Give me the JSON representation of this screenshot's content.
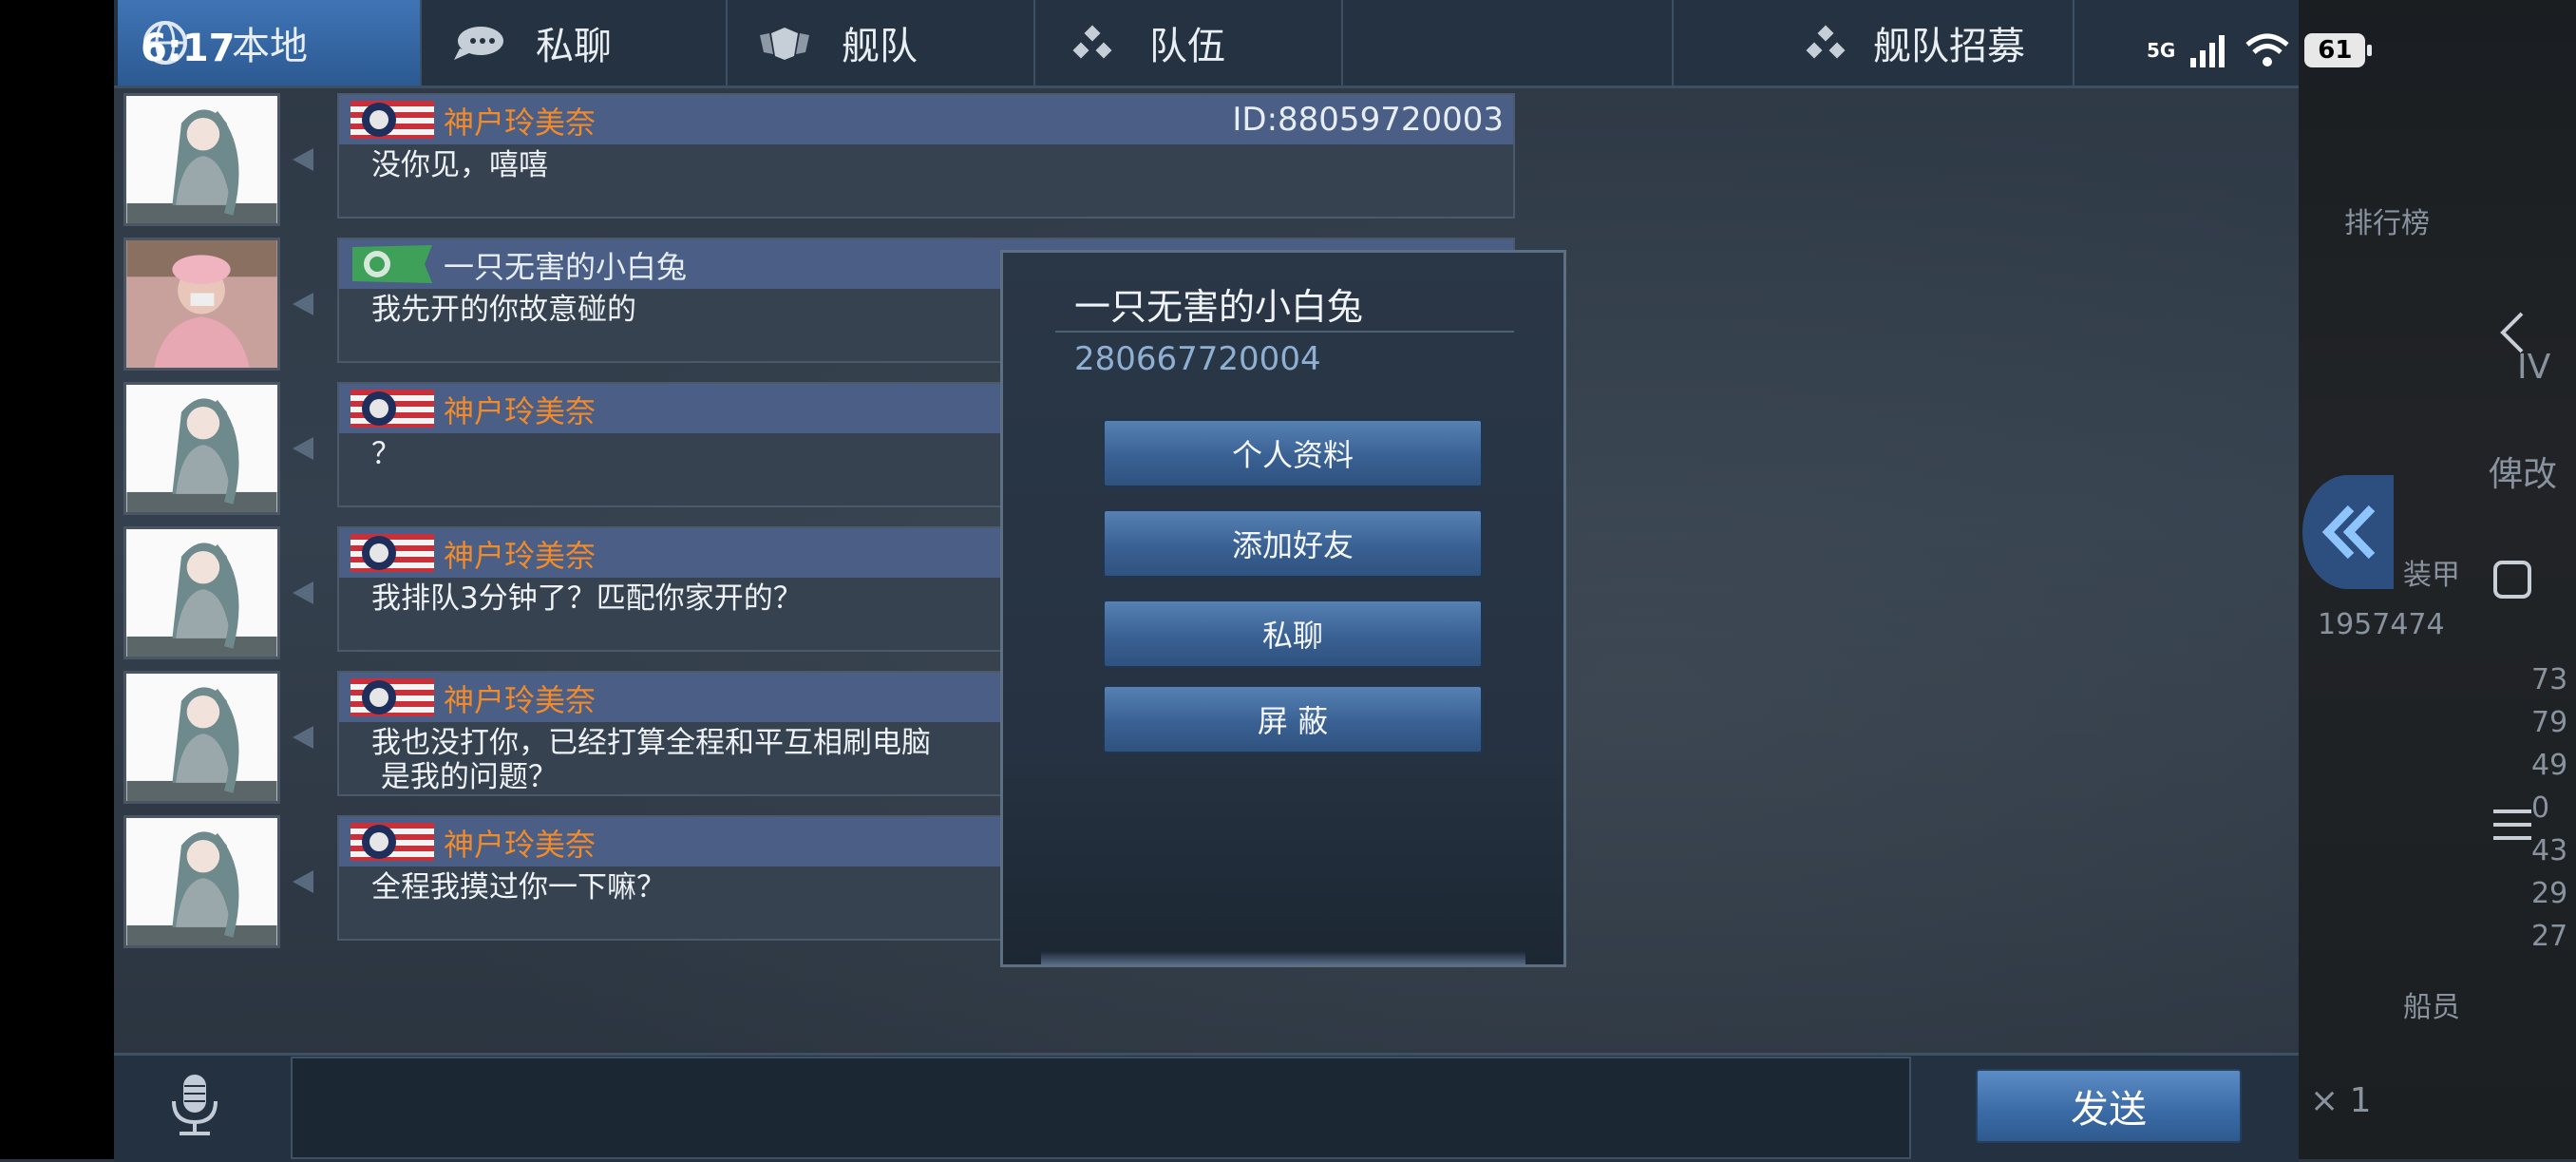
{
  "status_bar": {
    "time": "6:17",
    "network": "5G",
    "battery": "61"
  },
  "tabs": [
    {
      "label": "本地",
      "icon": "globe-icon",
      "active": true
    },
    {
      "label": "私聊",
      "icon": "chat-bubble-icon",
      "active": false
    },
    {
      "label": "舰队",
      "icon": "fleet-shield-icon",
      "active": false
    },
    {
      "label": "队伍",
      "icon": "team-dots-icon",
      "active": false
    },
    {
      "label": "舰队招募",
      "icon": "recruit-dots-icon",
      "active": false
    }
  ],
  "messages": [
    {
      "sender": "神户玲美奈",
      "player_id": "ID:88059720003",
      "text": "没你见，嘻嘻",
      "avatar": "anime-girl-avatar"
    },
    {
      "sender": "一只无害的小白兔",
      "text": "我先开的你故意碰的",
      "avatar": "person-photo-avatar"
    },
    {
      "sender": "神户玲美奈",
      "text": "？",
      "avatar": "anime-girl-avatar"
    },
    {
      "sender": "神户玲美奈",
      "text": "我排队3分钟了？匹配你家开的？",
      "avatar": "anime-girl-avatar"
    },
    {
      "sender": "神户玲美奈",
      "text": "我也没打你，已经打算全程和平互相刷电脑\n 是我的问题？",
      "avatar": "anime-girl-avatar"
    },
    {
      "sender": "神户玲美奈",
      "text": "全程我摸过你一下嘛？",
      "avatar": "anime-girl-avatar"
    }
  ],
  "popup": {
    "name": "一只无害的小白兔",
    "id": "280667720004",
    "buttons": [
      "个人资料",
      "添加好友",
      "私聊",
      "屏  蔽"
    ]
  },
  "bottom": {
    "send_label": "发送",
    "input_value": ""
  },
  "right_panel": {
    "rank_label": "排行榜",
    "ship_suffix": "IV",
    "ship_mod": "俾改",
    "armor_label": "装甲",
    "number": "1957474",
    "stats": [
      "73",
      "79",
      "49",
      "0",
      "43",
      "29",
      "27"
    ],
    "crew_label": "船员",
    "multiplier": "× 1"
  },
  "colors": {
    "accent": "#3f74b5",
    "sender_orange": "#f08a2a",
    "popup_id": "#8fb0d3"
  }
}
